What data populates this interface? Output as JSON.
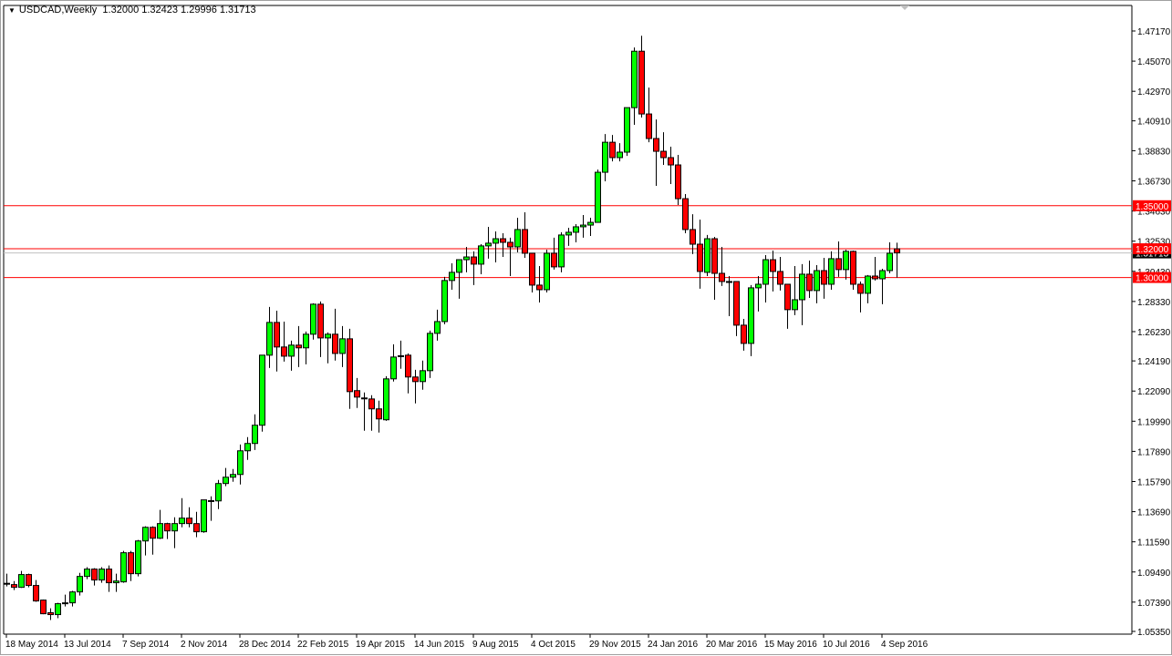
{
  "header": {
    "menu_icon": "triangle-down-icon",
    "symbol": "USDCAD,Weekly",
    "ohlc": "1.32000 1.32423 1.29996 1.31713"
  },
  "colors": {
    "bull": "#00ff00",
    "bear": "#ff0000",
    "hline": "#ff0000",
    "bid_line": "#c0c0c0",
    "wick": "#000000"
  },
  "chart_data": {
    "type": "candlestick",
    "title": "USDCAD,Weekly",
    "ylim": [
      1.0535,
      1.4717
    ],
    "y_ticks": [
      "1.47170",
      "1.45070",
      "1.42970",
      "1.40910",
      "1.38830",
      "1.36730",
      "1.34630",
      "1.32530",
      "1.30430",
      "1.28330",
      "1.26230",
      "1.24190",
      "1.22090",
      "1.19990",
      "1.17890",
      "1.15790",
      "1.13690",
      "1.11590",
      "1.09490",
      "1.07390",
      "1.05350"
    ],
    "x_ticks": [
      {
        "bar": 0,
        "label": "18 May 2014"
      },
      {
        "bar": 8,
        "label": "13 Jul 2014"
      },
      {
        "bar": 16,
        "label": "7 Sep 2014"
      },
      {
        "bar": 24,
        "label": "2 Nov 2014"
      },
      {
        "bar": 32,
        "label": "28 Dec 2014"
      },
      {
        "bar": 40,
        "label": "22 Feb 2015"
      },
      {
        "bar": 48,
        "label": "19 Apr 2015"
      },
      {
        "bar": 56,
        "label": "14 Jun 2015"
      },
      {
        "bar": 64,
        "label": "9 Aug 2015"
      },
      {
        "bar": 72,
        "label": "4 Oct 2015"
      },
      {
        "bar": 80,
        "label": "29 Nov 2015"
      },
      {
        "bar": 88,
        "label": "24 Jan 2016"
      },
      {
        "bar": 96,
        "label": "20 Mar 2016"
      },
      {
        "bar": 104,
        "label": "15 May 2016"
      },
      {
        "bar": 112,
        "label": "10 Jul 2016"
      },
      {
        "bar": 120,
        "label": "4 Sep 2016"
      }
    ],
    "horizontal_lines": [
      {
        "price": 1.35,
        "label": "1.35000"
      },
      {
        "price": 1.32,
        "label": "1.32000"
      },
      {
        "price": 1.3,
        "label": "1.30000"
      }
    ],
    "bid": {
      "price": 1.31713,
      "label": "1.31713"
    },
    "ohlc_fields": [
      "open",
      "high",
      "low",
      "close"
    ],
    "candles": [
      [
        1.0867,
        1.0937,
        1.0848,
        1.087
      ],
      [
        1.0861,
        1.0886,
        1.0823,
        1.0842
      ],
      [
        1.0842,
        1.0956,
        1.0838,
        1.0931
      ],
      [
        1.0931,
        1.0937,
        1.0842,
        1.0855
      ],
      [
        1.0855,
        1.0893,
        1.0741,
        1.0747
      ],
      [
        1.0753,
        1.0756,
        1.0655,
        1.0658
      ],
      [
        1.0665,
        1.0696,
        1.0614,
        1.0652
      ],
      [
        1.0652,
        1.0734,
        1.0627,
        1.0728
      ],
      [
        1.0728,
        1.0791,
        1.0709,
        1.0734
      ],
      [
        1.0734,
        1.0817,
        1.0709,
        1.081
      ],
      [
        1.081,
        1.0943,
        1.0785,
        1.0918
      ],
      [
        1.0918,
        1.0982,
        1.0899,
        1.0969
      ],
      [
        1.0969,
        1.0975,
        1.0855,
        1.0893
      ],
      [
        1.0893,
        1.0982,
        1.0874,
        1.0969
      ],
      [
        1.0969,
        1.0994,
        1.081,
        1.0874
      ],
      [
        1.0874,
        1.0937,
        1.081,
        1.0886
      ],
      [
        1.088,
        1.1096,
        1.0874,
        1.1083
      ],
      [
        1.1083,
        1.1096,
        1.0886,
        1.0937
      ],
      [
        1.0937,
        1.1172,
        1.0918,
        1.1165
      ],
      [
        1.1165,
        1.1267,
        1.1064,
        1.126
      ],
      [
        1.126,
        1.1267,
        1.107,
        1.1184
      ],
      [
        1.1184,
        1.1381,
        1.1178,
        1.1286
      ],
      [
        1.1286,
        1.1292,
        1.1178,
        1.1235
      ],
      [
        1.1235,
        1.133,
        1.1115,
        1.1286
      ],
      [
        1.1286,
        1.1463,
        1.126,
        1.1324
      ],
      [
        1.1324,
        1.14,
        1.126,
        1.1286
      ],
      [
        1.1286,
        1.1368,
        1.1191,
        1.1229
      ],
      [
        1.1229,
        1.1451,
        1.1222,
        1.1451
      ],
      [
        1.1444,
        1.1476,
        1.1305,
        1.1446
      ],
      [
        1.1444,
        1.159,
        1.1387,
        1.1565
      ],
      [
        1.1565,
        1.1673,
        1.1546,
        1.1609
      ],
      [
        1.1609,
        1.1666,
        1.1577,
        1.1628
      ],
      [
        1.1628,
        1.1837,
        1.1558,
        1.1793
      ],
      [
        1.1793,
        1.1888,
        1.173,
        1.1844
      ],
      [
        1.1844,
        1.2047,
        1.1799,
        1.1971
      ],
      [
        1.1971,
        1.2459,
        1.1926,
        1.2459
      ],
      [
        1.2459,
        1.2795,
        1.237,
        1.2687
      ],
      [
        1.2687,
        1.2769,
        1.2345,
        1.2516
      ],
      [
        1.2516,
        1.2693,
        1.2414,
        1.2452
      ],
      [
        1.2452,
        1.256,
        1.2351,
        1.2529
      ],
      [
        1.2529,
        1.2662,
        1.2376,
        1.251
      ],
      [
        1.251,
        1.2624,
        1.2395,
        1.2605
      ],
      [
        1.2605,
        1.282,
        1.2567,
        1.2814
      ],
      [
        1.2814,
        1.2833,
        1.2446,
        1.2579
      ],
      [
        1.2579,
        1.2617,
        1.2402,
        1.2605
      ],
      [
        1.2605,
        1.2782,
        1.2421,
        1.2471
      ],
      [
        1.2471,
        1.2662,
        1.2376,
        1.2573
      ],
      [
        1.2573,
        1.2643,
        1.2085,
        1.2205
      ],
      [
        1.2212,
        1.23,
        1.2091,
        1.2167
      ],
      [
        1.2161,
        1.2199,
        1.1933,
        1.2158
      ],
      [
        1.2154,
        1.218,
        1.1933,
        1.2085
      ],
      [
        1.2085,
        1.2142,
        1.192,
        1.2015
      ],
      [
        1.2009,
        1.2313,
        1.2002,
        1.2294
      ],
      [
        1.2294,
        1.2535,
        1.2275,
        1.2446
      ],
      [
        1.2452,
        1.256,
        1.2364,
        1.2455
      ],
      [
        1.2459,
        1.2471,
        1.2193,
        1.2307
      ],
      [
        1.2307,
        1.2357,
        1.2123,
        1.2275
      ],
      [
        1.2275,
        1.2421,
        1.2218,
        1.2351
      ],
      [
        1.2351,
        1.263,
        1.23,
        1.2611
      ],
      [
        1.2611,
        1.2776,
        1.256,
        1.2693
      ],
      [
        1.2693,
        1.3004,
        1.2674,
        1.2979
      ],
      [
        1.2979,
        1.3099,
        1.2915,
        1.3036
      ],
      [
        1.3036,
        1.3124,
        1.2852,
        1.3124
      ],
      [
        1.3124,
        1.3213,
        1.3036,
        1.3143
      ],
      [
        1.3143,
        1.3182,
        1.2947,
        1.3093
      ],
      [
        1.3093,
        1.3232,
        1.3023,
        1.322
      ],
      [
        1.322,
        1.3353,
        1.3131,
        1.3239
      ],
      [
        1.3239,
        1.3321,
        1.3105,
        1.327
      ],
      [
        1.327,
        1.3308,
        1.3143,
        1.3245
      ],
      [
        1.3245,
        1.3277,
        1.301,
        1.3213
      ],
      [
        1.3213,
        1.3416,
        1.3175,
        1.3334
      ],
      [
        1.3334,
        1.3454,
        1.3137,
        1.3169
      ],
      [
        1.3169,
        1.3169,
        1.2896,
        1.2947
      ],
      [
        1.2947,
        1.308,
        1.2826,
        1.2915
      ],
      [
        1.2915,
        1.3194,
        1.2896,
        1.3169
      ],
      [
        1.3169,
        1.3277,
        1.3055,
        1.3074
      ],
      [
        1.3074,
        1.3315,
        1.3036,
        1.3296
      ],
      [
        1.3296,
        1.3346,
        1.322,
        1.3315
      ],
      [
        1.3315,
        1.3372,
        1.3245,
        1.3353
      ],
      [
        1.3353,
        1.3435,
        1.3277,
        1.3365
      ],
      [
        1.3365,
        1.3416,
        1.3289,
        1.3384
      ],
      [
        1.3384,
        1.3752,
        1.3384,
        1.3733
      ],
      [
        1.3733,
        1.3999,
        1.367,
        1.3942
      ],
      [
        1.3942,
        1.3993,
        1.3809,
        1.3835
      ],
      [
        1.3835,
        1.3936,
        1.3809,
        1.3873
      ],
      [
        1.3873,
        1.4183,
        1.3847,
        1.4183
      ],
      [
        1.4183,
        1.4602,
        1.4063,
        1.4576
      ],
      [
        1.4576,
        1.4684,
        1.4114,
        1.4139
      ],
      [
        1.4139,
        1.4323,
        1.3942,
        1.3968
      ],
      [
        1.3968,
        1.4101,
        1.3638,
        1.3879
      ],
      [
        1.3879,
        1.4012,
        1.3784,
        1.3835
      ],
      [
        1.3835,
        1.3911,
        1.3651,
        1.3784
      ],
      [
        1.3784,
        1.3854,
        1.3505,
        1.3549
      ],
      [
        1.3549,
        1.3581,
        1.3308,
        1.3334
      ],
      [
        1.3334,
        1.3441,
        1.3163,
        1.3232
      ],
      [
        1.3232,
        1.3403,
        1.2922,
        1.3042
      ],
      [
        1.3036,
        1.3296,
        1.301,
        1.327
      ],
      [
        1.327,
        1.3283,
        1.2845,
        1.3029
      ],
      [
        1.3029,
        1.3213,
        1.2941,
        1.2972
      ],
      [
        1.2972,
        1.301,
        1.2731,
        1.297
      ],
      [
        1.2972,
        1.2972,
        1.2592,
        1.2668
      ],
      [
        1.2668,
        1.2712,
        1.249,
        1.2541
      ],
      [
        1.2541,
        1.2947,
        1.2452,
        1.2928
      ],
      [
        1.2928,
        1.301,
        1.2763,
        1.2953
      ],
      [
        1.2953,
        1.3156,
        1.2826,
        1.3124
      ],
      [
        1.3124,
        1.3188,
        1.2903,
        1.3042
      ],
      [
        1.3042,
        1.3143,
        1.2909,
        1.2953
      ],
      [
        1.2953,
        1.2953,
        1.2643,
        1.2776
      ],
      [
        1.2776,
        1.308,
        1.2738,
        1.2845
      ],
      [
        1.2845,
        1.3093,
        1.2668,
        1.3023
      ],
      [
        1.3023,
        1.3118,
        1.2858,
        1.2909
      ],
      [
        1.2909,
        1.3086,
        1.282,
        1.3048
      ],
      [
        1.3048,
        1.3137,
        1.2852,
        1.2953
      ],
      [
        1.2953,
        1.3182,
        1.2915,
        1.3131
      ],
      [
        1.3131,
        1.3251,
        1.3004,
        1.3055
      ],
      [
        1.3055,
        1.3194,
        1.2985,
        1.3182
      ],
      [
        1.3182,
        1.3188,
        1.2915,
        1.2953
      ],
      [
        1.2953,
        1.2972,
        1.2757,
        1.289
      ],
      [
        1.289,
        1.3017,
        1.282,
        1.301
      ],
      [
        1.301,
        1.3143,
        1.2979,
        1.2991
      ],
      [
        1.2991,
        1.3061,
        1.2814,
        1.3048
      ],
      [
        1.3048,
        1.3245,
        1.3029,
        1.3169
      ],
      [
        1.32,
        1.32423,
        1.29996,
        1.31713
      ]
    ]
  }
}
